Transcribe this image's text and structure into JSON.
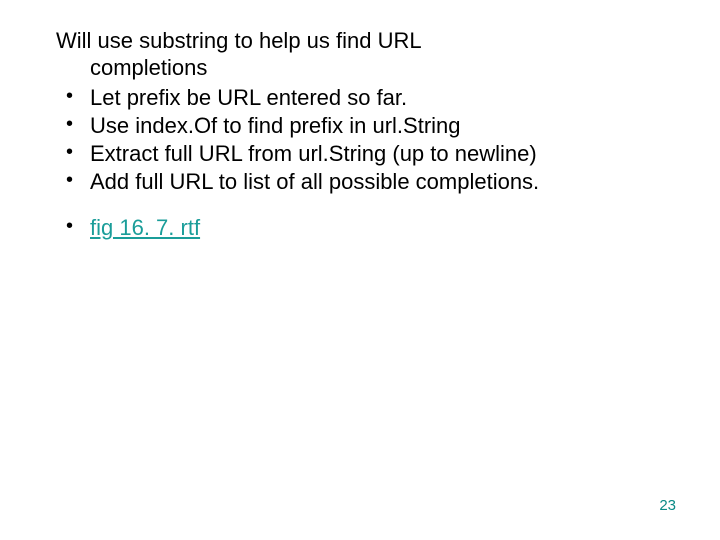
{
  "lead": {
    "line1": "Will use substring to help us find URL",
    "line2": "completions"
  },
  "bullets": [
    "Let prefix be URL entered so far.",
    "Use index.Of to find prefix in url.String",
    "Extract full URL from url.String (up to newline)",
    "Add full URL to list of all possible completions."
  ],
  "link_bullet": "fig 16. 7. rtf",
  "page_number": "23"
}
